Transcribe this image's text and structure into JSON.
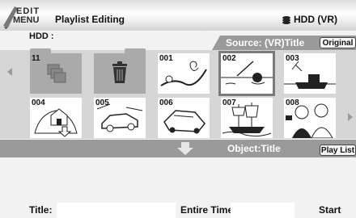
{
  "header": {
    "menu_badge": {
      "line1": "EDIT",
      "line2": "MENU"
    },
    "title": "Playlist Editing",
    "hdd_status": "HDD (VR)",
    "hdd_sub": "HDD :"
  },
  "source": {
    "label": "Source: (VR)Title",
    "button": "Original"
  },
  "thumbnails": [
    {
      "num": "11",
      "kind": "folder-group",
      "icon": "stack-icon"
    },
    {
      "num": "",
      "kind": "folder-trash",
      "icon": "trash-icon"
    },
    {
      "num": "001",
      "kind": "clip",
      "icon": "bird-branch-icon"
    },
    {
      "num": "002",
      "kind": "clip",
      "icon": "fishing-icon",
      "selected": true
    },
    {
      "num": "003",
      "kind": "clip",
      "icon": "ship-icon"
    },
    {
      "num": "004",
      "kind": "clip",
      "icon": "house-icon"
    },
    {
      "num": "005",
      "kind": "clip",
      "icon": "car-icon"
    },
    {
      "num": "006",
      "kind": "clip",
      "icon": "car-tilted-icon"
    },
    {
      "num": "007",
      "kind": "clip",
      "icon": "sailing-ship-icon"
    },
    {
      "num": "008",
      "kind": "clip",
      "icon": "people-icon"
    }
  ],
  "object": {
    "label": "Object:Title",
    "button": "Play List"
  },
  "info": {
    "title_label": "Title:",
    "entire_time_label": "Entire Time:",
    "start_label": "Start"
  },
  "colors": {
    "panel_gray": "#9a9a9a",
    "grid_bg": "#d6d6d6",
    "page_bg": "#f2f2f2"
  }
}
